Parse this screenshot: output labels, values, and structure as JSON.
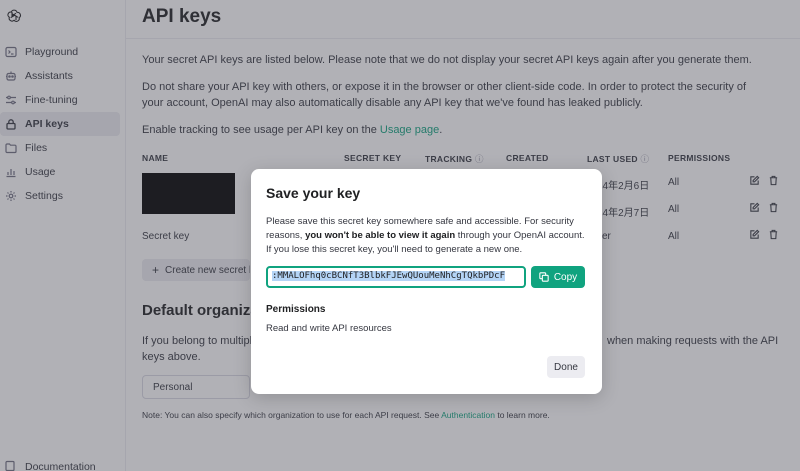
{
  "sidebar": {
    "items": [
      {
        "label": "Playground",
        "icon": "terminal-icon"
      },
      {
        "label": "Assistants",
        "icon": "robot-icon"
      },
      {
        "label": "Fine-tuning",
        "icon": "sliders-icon"
      },
      {
        "label": "API keys",
        "icon": "lock-icon",
        "active": true
      },
      {
        "label": "Files",
        "icon": "folder-icon"
      },
      {
        "label": "Usage",
        "icon": "chart-icon"
      },
      {
        "label": "Settings",
        "icon": "gear-icon"
      }
    ],
    "bottom_item": "Documentation"
  },
  "main": {
    "title": "API keys",
    "para1": "Your secret API keys are listed below. Please note that we do not display your secret API keys again after you generate them.",
    "para2": "Do not share your API key with others, or expose it in the browser or other client-side code. In order to protect the security of your account, OpenAI may also automatically disable any API key that we've found has leaked publicly.",
    "para3_prefix": "Enable tracking to see usage per API key on the ",
    "para3_link": "Usage page",
    "para3_suffix": ".",
    "table": {
      "headers": [
        "NAME",
        "SECRET KEY",
        "TRACKING",
        "CREATED",
        "LAST USED",
        "PERMISSIONS"
      ],
      "rows": [
        {
          "name": "",
          "last_used": "24年2月6日",
          "permissions": "All"
        },
        {
          "name": "",
          "last_used": "24年2月7日",
          "permissions": "All"
        },
        {
          "name": "Secret key",
          "last_used": "ver",
          "permissions": "All"
        }
      ]
    },
    "create_button": "Create new secret ke",
    "default_org_title": "Default organiza",
    "default_org_text_left": "If you belong to multipl",
    "default_org_text_left2": "keys above.",
    "default_org_text_right": "when making requests with the API",
    "org_select": "Personal",
    "note_prefix": "Note: You can also specify which organization to use for each API request. See ",
    "note_link": "Authentication",
    "note_suffix": " to learn more."
  },
  "modal": {
    "title": "Save your key",
    "text_part1": "Please save this secret key somewhere safe and accessible. For security reasons, ",
    "text_bold": "you won't be able to view it again",
    "text_part2": " through your OpenAI account. If you lose this secret key, you'll need to generate a new one.",
    "key_value": ":MMALOFhq0cBCNfT3BlbkFJEwQUouMeNhCgTQkbPDcF",
    "copy_label": "Copy",
    "permissions_label": "Permissions",
    "permissions_value": "Read and write API resources",
    "done_label": "Done"
  },
  "colors": {
    "accent": "#10a37f",
    "overlay": "#464650",
    "selection": "#b4d4f6"
  }
}
